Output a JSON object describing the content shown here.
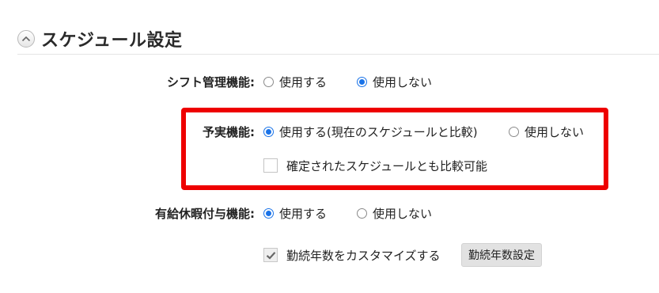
{
  "section": {
    "title": "スケジュール設定",
    "collapse_icon": "chevron-up-icon"
  },
  "shift": {
    "label": "シフト管理機能:",
    "options": [
      "使用する",
      "使用しない"
    ],
    "selected": 1
  },
  "forecast": {
    "label": "予実機能:",
    "options": [
      "使用する(現在のスケジュールと比較)",
      "使用しない"
    ],
    "selected": 0,
    "compare_checkbox": {
      "label": "確定されたスケジュールとも比較可能",
      "checked": false
    }
  },
  "paid_leave": {
    "label": "有給休暇付与機能:",
    "options": [
      "使用する",
      "使用しない"
    ],
    "selected": 0,
    "customize_checkbox": {
      "label": "勤続年数をカスタマイズする",
      "checked": true
    },
    "settings_button": "勤続年数設定"
  },
  "colors": {
    "accent": "#1a73e8",
    "highlight": "#ee0000"
  }
}
